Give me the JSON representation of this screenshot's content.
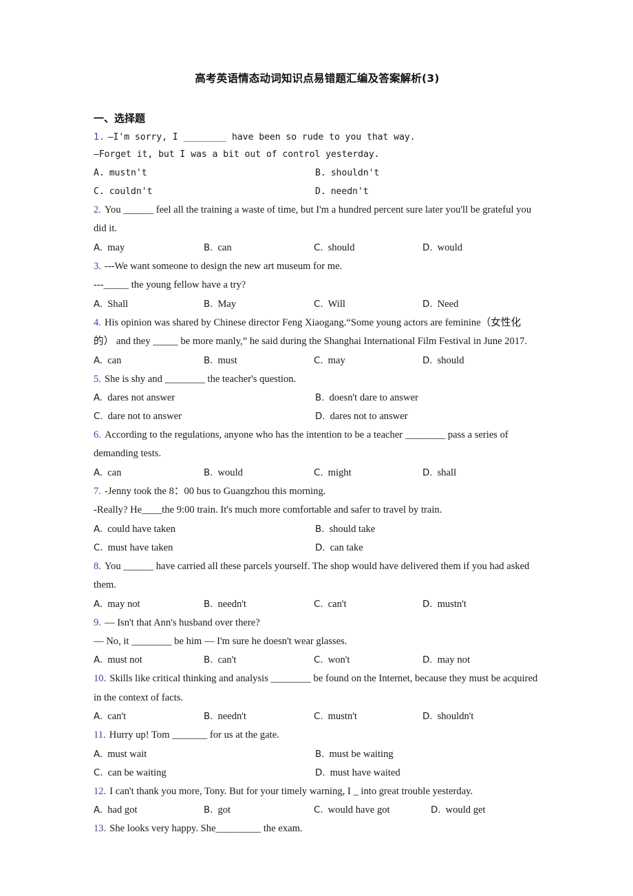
{
  "document": {
    "title": "高考英语情态动词知识点易错题汇编及答案解析(3)",
    "section_heading": "一、选择题",
    "number_color": "#4141a8"
  },
  "questions": [
    {
      "num": "1.",
      "font": "mono",
      "lines": [
        "—I'm sorry, I ________ have been so rude to you that way.",
        "—Forget it, but I was a bit out of control yesterday."
      ],
      "layout": "two",
      "options": [
        {
          "label": "A.",
          "text": "mustn't"
        },
        {
          "label": "B.",
          "text": "shouldn't"
        },
        {
          "label": "C.",
          "text": "couldn't"
        },
        {
          "label": "D.",
          "text": "needn't"
        }
      ]
    },
    {
      "num": "2.",
      "font": "serif",
      "lines": [
        "You ______ feel all the training a waste of time, but I'm a hundred percent sure later you'll be grateful you did it."
      ],
      "layout": "four",
      "options": [
        {
          "label": "A.",
          "text": "may"
        },
        {
          "label": "B.",
          "text": "can"
        },
        {
          "label": "C.",
          "text": "should"
        },
        {
          "label": "D.",
          "text": "would"
        }
      ]
    },
    {
      "num": "3.",
      "font": "serif",
      "lines": [
        "---We want someone to design the new art museum for me.",
        "---_____ the young fellow have a try?"
      ],
      "layout": "four",
      "options": [
        {
          "label": "A.",
          "text": "Shall"
        },
        {
          "label": "B.",
          "text": "May"
        },
        {
          "label": "C.",
          "text": "Will"
        },
        {
          "label": "D.",
          "text": "Need"
        }
      ]
    },
    {
      "num": "4.",
      "font": "serif",
      "lines": [
        "His opinion was shared by Chinese director Feng Xiaogang.“Some young actors are feminine（女性化的） and they _____ be more manly,” he said during the Shanghai International Film Festival in June 2017."
      ],
      "layout": "four",
      "options": [
        {
          "label": "A.",
          "text": "can"
        },
        {
          "label": "B.",
          "text": "must"
        },
        {
          "label": "C.",
          "text": "may"
        },
        {
          "label": "D.",
          "text": "should"
        }
      ]
    },
    {
      "num": "5.",
      "font": "serif",
      "lines": [
        "She is shy and ________ the teacher's question."
      ],
      "layout": "two",
      "options": [
        {
          "label": "A.",
          "text": "dares not answer"
        },
        {
          "label": "B.",
          "text": "doesn't dare to answer"
        },
        {
          "label": "C.",
          "text": "dare not to answer"
        },
        {
          "label": "D.",
          "text": "dares not to answer"
        }
      ]
    },
    {
      "num": "6.",
      "font": "serif",
      "lines": [
        "According to the regulations, anyone who has the intention to be a teacher ________ pass a series of demanding tests."
      ],
      "layout": "four",
      "options": [
        {
          "label": "A.",
          "text": "can"
        },
        {
          "label": "B.",
          "text": "would"
        },
        {
          "label": "C.",
          "text": "might"
        },
        {
          "label": "D.",
          "text": "shall"
        }
      ]
    },
    {
      "num": "7.",
      "font": "serif",
      "lines": [
        "-Jenny took the 8：00 bus to Guangzhou this morning.",
        "-Really? He____the 9:00 train. It's much more  comfortable and safer to travel by train."
      ],
      "layout": "two",
      "options": [
        {
          "label": "A.",
          "text": "could have taken"
        },
        {
          "label": "B.",
          "text": "should take"
        },
        {
          "label": "C.",
          "text": "must have taken"
        },
        {
          "label": "D.",
          "text": "can take"
        }
      ]
    },
    {
      "num": "8.",
      "font": "serif",
      "lines": [
        "You ______ have carried all these parcels yourself. The shop would have delivered them if you had asked them."
      ],
      "layout": "four",
      "options": [
        {
          "label": "A.",
          "text": "may not"
        },
        {
          "label": "B.",
          "text": "needn't"
        },
        {
          "label": "C.",
          "text": "can't"
        },
        {
          "label": "D.",
          "text": "mustn't"
        }
      ]
    },
    {
      "num": "9.",
      "font": "serif",
      "lines": [
        "— Isn't that Ann's husband over there?",
        "— No, it ________ be him — I'm sure he doesn't wear glasses."
      ],
      "layout": "four",
      "options": [
        {
          "label": "A.",
          "text": "must not"
        },
        {
          "label": "B.",
          "text": "can't"
        },
        {
          "label": "C.",
          "text": "won't"
        },
        {
          "label": "D.",
          "text": "may not"
        }
      ]
    },
    {
      "num": "10.",
      "font": "serif",
      "lines": [
        "Skills like critical thinking and analysis ________ be found on the Internet, because they must be acquired in the context of facts."
      ],
      "layout": "four",
      "options": [
        {
          "label": "A.",
          "text": "can't"
        },
        {
          "label": "B.",
          "text": "needn't"
        },
        {
          "label": "C.",
          "text": "mustn't"
        },
        {
          "label": "D.",
          "text": "shouldn't"
        }
      ]
    },
    {
      "num": "11.",
      "font": "serif",
      "lines": [
        "Hurry up! Tom _______ for us at the gate."
      ],
      "layout": "two",
      "options": [
        {
          "label": "A.",
          "text": "must wait"
        },
        {
          "label": "B.",
          "text": "must be waiting"
        },
        {
          "label": "C.",
          "text": "can be waiting"
        },
        {
          "label": "D.",
          "text": "must have waited"
        }
      ]
    },
    {
      "num": "12.",
      "font": "serif",
      "lines": [
        "I can't thank you more, Tony. But for your timely warning, I _ into great trouble yesterday."
      ],
      "layout": "four-tight",
      "options": [
        {
          "label": "A.",
          "text": "had got"
        },
        {
          "label": "B.",
          "text": "got"
        },
        {
          "label": "C.",
          "text": "would have got"
        },
        {
          "label": "D.",
          "text": "would get"
        }
      ]
    },
    {
      "num": "13.",
      "font": "serif",
      "lines": [
        "She looks very happy. She_________ the exam."
      ],
      "layout": "none",
      "options": []
    }
  ]
}
